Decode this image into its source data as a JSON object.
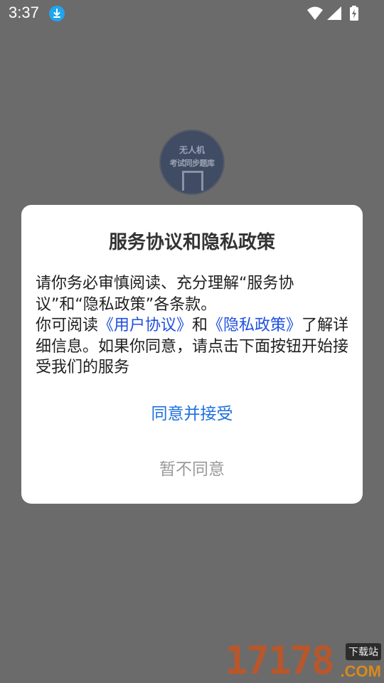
{
  "status_bar": {
    "time": "3:37",
    "icons": [
      "download-icon",
      "wifi-icon",
      "signal-icon",
      "battery-charging-icon"
    ]
  },
  "app_logo": {
    "line1": "无人机",
    "line2": "考试同步题库"
  },
  "dialog": {
    "title": "服务协议和隐私政策",
    "body": {
      "p1": "请你务必审慎阅读、充分理解“服务协议”和“隐私政策”各条款。",
      "p2_prefix": "你可阅读",
      "user_agreement_link": "《用户协议》",
      "p2_mid": "和",
      "privacy_policy_link": "《隐私政策》",
      "p2_suffix": "了解详细信息。如果你同意，请点击下面按钮开始接受我们的服务"
    },
    "accept_label": "同意并接受",
    "decline_label": "暂不同意"
  },
  "watermark": {
    "digits": "17178",
    "tag": "下载站",
    "domain": ".COM"
  },
  "colors": {
    "overlay": "#6b6b6b",
    "link": "#1f4fe0",
    "accept": "#1d6fe0",
    "decline": "#9a9a9a"
  }
}
